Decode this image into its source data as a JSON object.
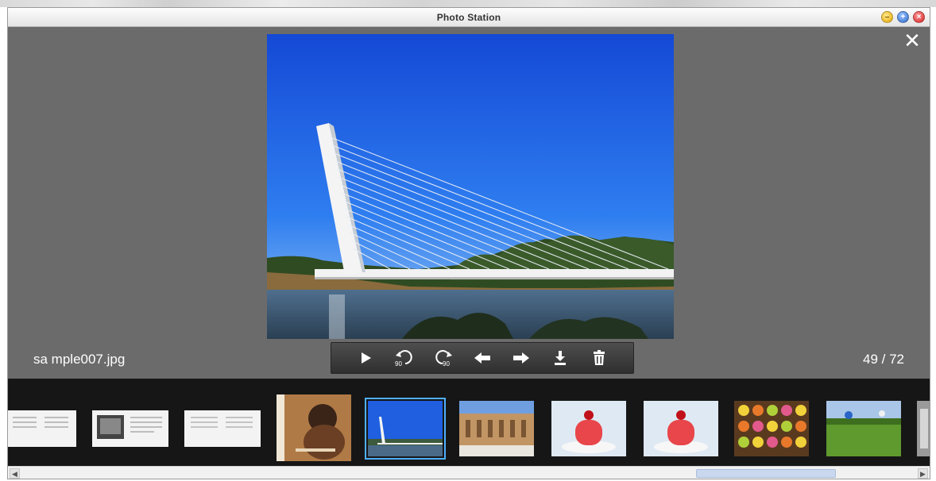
{
  "window": {
    "title": "Photo Station",
    "buttons": {
      "minimize": "–",
      "maximize": "+",
      "close": "×"
    }
  },
  "viewer": {
    "close_label": "✕",
    "filename": "sa mple007.jpg",
    "counter": "49 / 72"
  },
  "toolbar": {
    "buttons": [
      "play-icon",
      "rotate-left-90-icon",
      "rotate-right-90-icon",
      "previous-arrow-icon",
      "next-arrow-icon",
      "download-icon",
      "delete-icon"
    ],
    "rotate_label": "90"
  },
  "filmstrip": {
    "thumbnails": [
      "document-page",
      "document-with-photo",
      "document-page",
      "album-cover-portrait",
      "bridge-sky",
      "palace-courtyard",
      "dessert-cake",
      "dessert-cake",
      "macarons",
      "green-field",
      "partial-edge"
    ],
    "selected_index": 4
  },
  "scrollbar": {
    "thumb_label": "III"
  },
  "colors": {
    "selection": "#4fb0ff",
    "viewer_bg": "#6b6b6b",
    "filmstrip_bg": "#161616",
    "sky": "#1e63e0"
  }
}
